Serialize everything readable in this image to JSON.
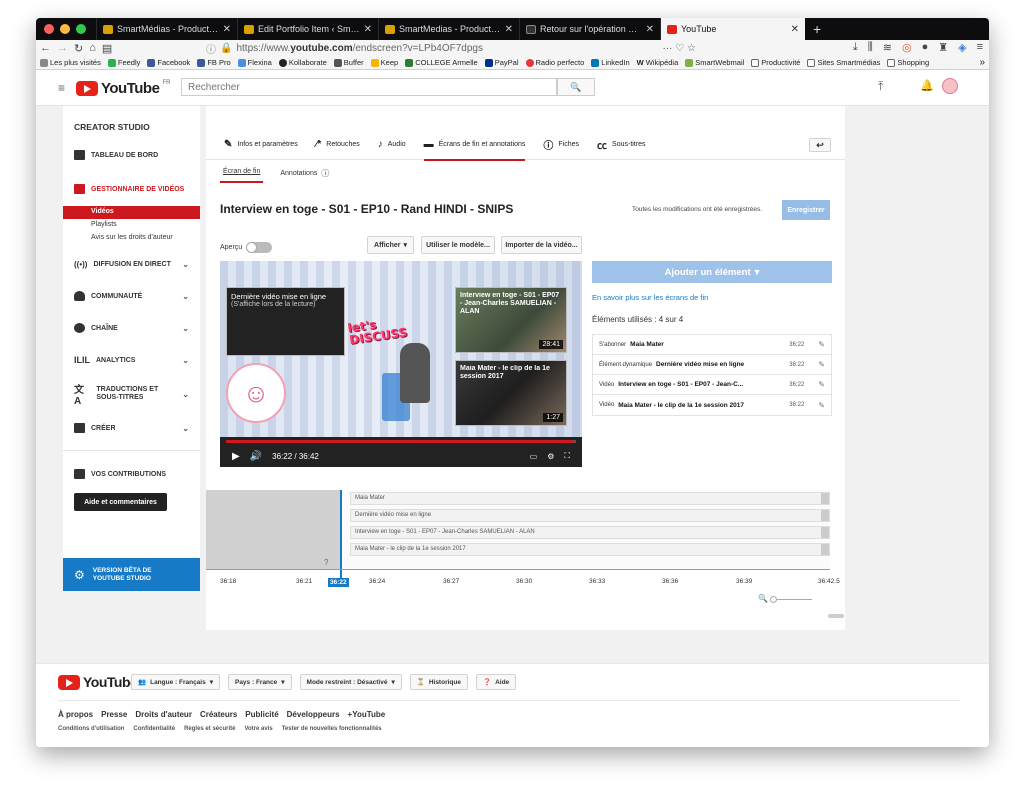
{
  "browser": {
    "tabs": [
      {
        "title": "SmartMédias - Production aud"
      },
      {
        "title": "Edit Portfolio Item ‹ SmartMédi"
      },
      {
        "title": "SmartMedias - Production aud"
      },
      {
        "title": "Retour sur l'opération Turquoi"
      },
      {
        "title": "YouTube"
      }
    ],
    "url_prefix": "https://www.",
    "url_host": "youtube.com",
    "url_path": "/endscreen?v=LPb4OF7dpgs",
    "bookmarks": [
      "Les plus visités",
      "Feedly",
      "Facebook",
      "FB Pro",
      "Flexina",
      "Kollaborate",
      "Buffer",
      "Keep",
      "COLLEGE Armelle",
      "PayPal",
      "Radio perfecto",
      "LinkedIn",
      "Wikipédia",
      "SmartWebmail",
      "Productivité",
      "Sites Smartmédias",
      "Shopping"
    ]
  },
  "yt": {
    "logo": "YouTube",
    "logo_sup": "FR",
    "search_placeholder": "Rechercher"
  },
  "sidebar": {
    "title": "CREATOR STUDIO",
    "dashboard": "TABLEAU DE BORD",
    "video_manager": "GESTIONNAIRE DE VIDÉOS",
    "sub": [
      "Vidéos",
      "Playlists",
      "Avis sur les droits d'auteur"
    ],
    "sections": [
      "DIFFUSION EN DIRECT",
      "COMMUNAUTÉ",
      "CHAÎNE",
      "ANALYTICS",
      "TRADUCTIONS ET SOUS-TITRES",
      "CRÉER"
    ],
    "contributions": "VOS CONTRIBUTIONS",
    "help": "Aide et commentaires",
    "beta": "VERSION BÊTA DE YOUTUBE STUDIO"
  },
  "main": {
    "tabs": [
      "Infos et paramètres",
      "Retouches",
      "Audio",
      "Écrans de fin et annotations",
      "Fiches",
      "Sous-titres"
    ],
    "subtabs": [
      "Écran de fin",
      "Annotations"
    ],
    "video_title": "Interview en toge - S01 - EP10 - Rand HINDI - SNIPS",
    "saved_msg": "Toutes les modifications ont été enregistrées.",
    "save_btn": "Enregistrer",
    "preview_label": "Aperçu",
    "btn_show": "Afficher",
    "btn_template": "Utiliser le modèle...",
    "btn_import": "Importer de la vidéo..."
  },
  "video": {
    "el1_title": "Dernière vidéo mise en ligne",
    "el1_sub": "(S'affiche lors de la lecture)",
    "el2_title": "Interview en toge - S01 - EP07 - Jean-Charles SAMUELIAN - ALAN",
    "el2_dur": "28:41",
    "el3_title": "Maia Mater - le clip de la 1e session 2017",
    "el3_dur": "1:27",
    "sticker": "let's DISCUSS",
    "time": "36:22 / 36:42",
    "progress": 0.99
  },
  "panel": {
    "add_btn": "Ajouter un élément",
    "learn_more": "En savoir plus sur les écrans de fin",
    "used": "Éléments utilisés : 4 sur 4",
    "rows": [
      {
        "type": "S'abonner",
        "name": "Maia Mater",
        "time": "36:22"
      },
      {
        "type": "Élément dynamique",
        "name": "Dernière vidéo mise en ligne",
        "time": "36:22"
      },
      {
        "type": "Vidéo",
        "name": "Interview en toge - S01 - EP07 - Jean-C...",
        "time": "36:22"
      },
      {
        "type": "Vidéo",
        "name": "Maia Mater - le clip de la 1e session 2017",
        "time": "36:22"
      }
    ]
  },
  "timeline": {
    "rows": [
      "Maia Mater",
      "Dernière vidéo mise en ligne",
      "Interview en toge - S01 - EP07 - Jean-Charles SAMUELIAN - ALAN",
      "Maia Mater - le clip de la 1e session 2017"
    ],
    "ticks": [
      "36:18",
      "36:21",
      "36:22",
      "36:24",
      "36:27",
      "36:30",
      "36:33",
      "36:36",
      "36:39",
      "36:42.5"
    ]
  },
  "footer": {
    "lang": "Langue : Français",
    "country": "Pays : France",
    "restricted": "Mode restreint : Désactivé",
    "history": "Historique",
    "help": "Aide",
    "links": [
      "À propos",
      "Presse",
      "Droits d'auteur",
      "Créateurs",
      "Publicité",
      "Développeurs",
      "+YouTube"
    ],
    "links2": [
      "Conditions d'utilisation",
      "Confidentialité",
      "Règles et sécurité",
      "Votre avis",
      "Tester de nouvelles fonctionnalités"
    ]
  }
}
